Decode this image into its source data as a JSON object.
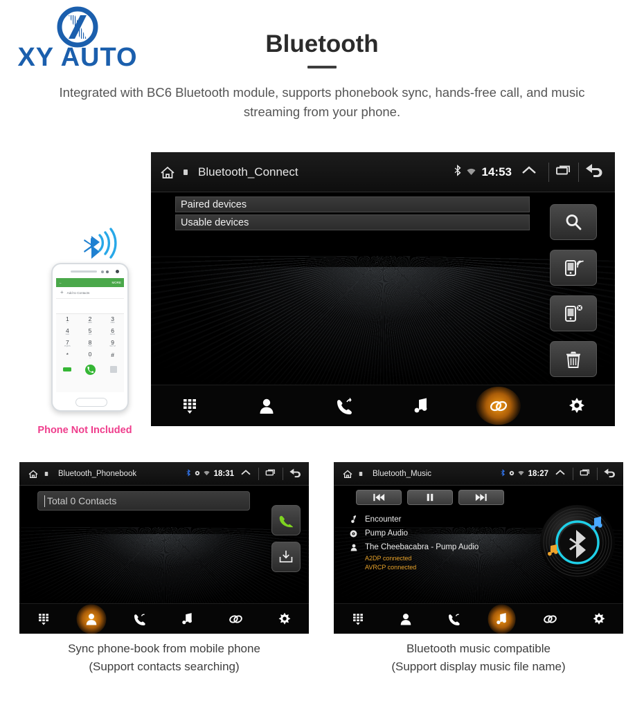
{
  "brand": {
    "name": "XY AUTO",
    "color": "#1b5fad",
    "logo_icon": "xy-auto-circle-x-logo"
  },
  "header": {
    "title": "Bluetooth",
    "subtitle": "Integrated with BC6 Bluetooth module, supports phonebook sync, hands-free call, and music streaming from your phone."
  },
  "phone_illustration": {
    "caption": "Phone Not Included",
    "caption_color": "#ef3d8c",
    "bluetooth_icon": "bluetooth-signal-icon",
    "app": {
      "back_icon": "back-arrow-icon",
      "more_label": "MORE",
      "add_contact_label": "Add to Contacts",
      "keys": [
        {
          "digit": "1",
          "sub": "∞"
        },
        {
          "digit": "2",
          "sub": "ABC"
        },
        {
          "digit": "3",
          "sub": "DEF"
        },
        {
          "digit": "4",
          "sub": "GHI"
        },
        {
          "digit": "5",
          "sub": "JKL"
        },
        {
          "digit": "6",
          "sub": "MNO"
        },
        {
          "digit": "7",
          "sub": "PQRS"
        },
        {
          "digit": "8",
          "sub": "TUV"
        },
        {
          "digit": "9",
          "sub": "WXYZ"
        },
        {
          "digit": "*",
          "sub": ""
        },
        {
          "digit": "0",
          "sub": "+"
        },
        {
          "digit": "#",
          "sub": ""
        }
      ]
    }
  },
  "main_screen": {
    "status": {
      "home_icon": "home-icon",
      "title": "Bluetooth_Connect",
      "bluetooth_icon": "bluetooth-icon",
      "wifi_icon": "wifi-icon",
      "time": "14:53",
      "expand_icon": "chevron-up-icon",
      "recents_icon": "recents-icon",
      "back_icon": "back-arrow-icon"
    },
    "device_lists": [
      {
        "label": "Paired devices"
      },
      {
        "label": "Usable devices"
      }
    ],
    "side_buttons": [
      {
        "name": "search-button",
        "icon": "search-icon"
      },
      {
        "name": "connect-device-button",
        "icon": "phone-connect-icon"
      },
      {
        "name": "disconnect-device-button",
        "icon": "phone-disconnect-icon"
      },
      {
        "name": "delete-device-button",
        "icon": "trash-icon"
      }
    ],
    "nav": [
      {
        "name": "dialpad",
        "icon": "dialpad-icon",
        "active": false
      },
      {
        "name": "contacts",
        "icon": "contact-icon",
        "active": false
      },
      {
        "name": "call-history",
        "icon": "call-history-icon",
        "active": false
      },
      {
        "name": "music",
        "icon": "music-note-icon",
        "active": false
      },
      {
        "name": "link",
        "icon": "link-icon",
        "active": true
      },
      {
        "name": "settings",
        "icon": "gear-icon",
        "active": false
      }
    ]
  },
  "phonebook_screen": {
    "status": {
      "home_icon": "home-icon",
      "title": "Bluetooth_Phonebook",
      "bluetooth_icon": "bluetooth-icon",
      "wifi_icon": "wifi-icon",
      "time": "18:31",
      "expand_icon": "chevron-up-icon",
      "recents_icon": "recents-icon",
      "back_icon": "back-arrow-icon"
    },
    "search_value": "Total 0 Contacts",
    "side_buttons": [
      {
        "name": "dial-button",
        "icon": "green-phone-icon"
      },
      {
        "name": "download-contacts-button",
        "icon": "download-inbox-icon"
      }
    ],
    "nav": [
      {
        "name": "dialpad",
        "icon": "dialpad-icon",
        "active": false
      },
      {
        "name": "contacts",
        "icon": "contact-icon",
        "active": true
      },
      {
        "name": "call-history",
        "icon": "call-history-icon",
        "active": false
      },
      {
        "name": "music",
        "icon": "music-note-icon",
        "active": false
      },
      {
        "name": "link",
        "icon": "link-icon",
        "active": false
      },
      {
        "name": "settings",
        "icon": "gear-icon",
        "active": false
      }
    ],
    "caption_line1": "Sync phone-book from mobile phone",
    "caption_line2": "(Support contacts searching)"
  },
  "music_screen": {
    "status": {
      "home_icon": "home-icon",
      "title": "Bluetooth_Music",
      "bluetooth_icon": "bluetooth-icon",
      "wifi_icon": "wifi-icon",
      "time": "18:27",
      "expand_icon": "chevron-up-icon",
      "recents_icon": "recents-icon",
      "back_icon": "back-arrow-icon"
    },
    "transport": [
      {
        "name": "previous-track-button",
        "icon": "skip-previous-icon"
      },
      {
        "name": "pause-button",
        "icon": "pause-icon"
      },
      {
        "name": "next-track-button",
        "icon": "skip-next-icon"
      }
    ],
    "track": {
      "title": "Encounter",
      "album": "Pump Audio",
      "artist": "The Cheebacabra - Pump Audio",
      "title_icon": "music-note-icon",
      "album_icon": "disc-icon",
      "artist_icon": "person-icon"
    },
    "connection_status": {
      "a2dp": "A2DP connected",
      "avrcp": "AVRCP connected",
      "color": "#e8a32a"
    },
    "artwork_icon": "vinyl-bluetooth-icon",
    "nav": [
      {
        "name": "dialpad",
        "icon": "dialpad-icon",
        "active": false
      },
      {
        "name": "contacts",
        "icon": "contact-icon",
        "active": false
      },
      {
        "name": "call-history",
        "icon": "call-history-icon",
        "active": false
      },
      {
        "name": "music",
        "icon": "music-note-icon",
        "active": true
      },
      {
        "name": "link",
        "icon": "link-icon",
        "active": false
      },
      {
        "name": "settings",
        "icon": "gear-icon",
        "active": false
      }
    ],
    "caption_line1": "Bluetooth music compatible",
    "caption_line2": "(Support display music file name)"
  }
}
